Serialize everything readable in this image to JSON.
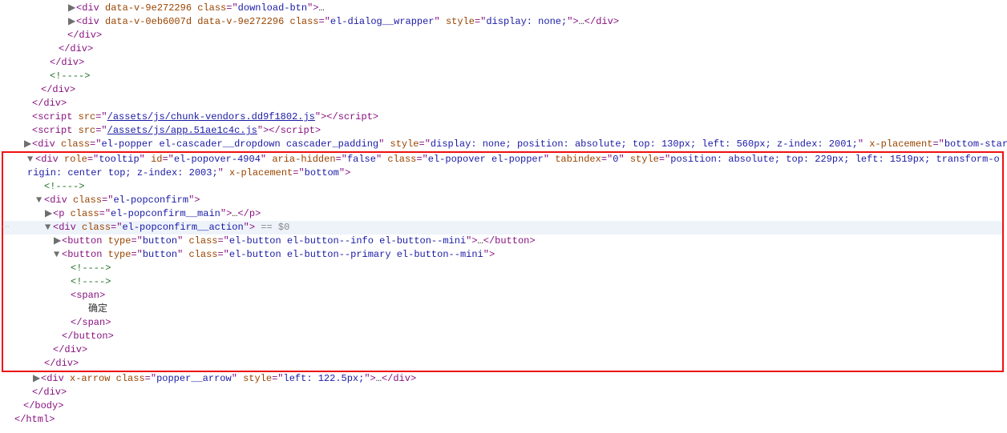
{
  "structure": {
    "nodes": [
      {
        "id": "n0",
        "indent": 7,
        "type": "open_ell",
        "caret": "right",
        "text": {
          "tag": "div",
          "attrs": [
            {
              "n": "data-v-9e272296",
              "v": ""
            },
            {
              "n": "class",
              "v": "download-btn"
            }
          ]
        }
      },
      {
        "id": "n1",
        "indent": 7,
        "type": "open_close_ell",
        "caret": "right",
        "text": {
          "tag": "div",
          "attrs": [
            {
              "n": "data-v-0eb6007d",
              "v": ""
            },
            {
              "n": "data-v-9e272296",
              "v": ""
            },
            {
              "n": "class",
              "v": "el-dialog__wrapper"
            },
            {
              "n": "style",
              "v": "display: none;"
            }
          ]
        }
      },
      {
        "id": "n2",
        "indent": 6,
        "type": "close",
        "text": {
          "tag": "div"
        }
      },
      {
        "id": "n3",
        "indent": 5,
        "type": "close",
        "text": {
          "tag": "div"
        }
      },
      {
        "id": "n4",
        "indent": 4,
        "type": "close",
        "text": {
          "tag": "div"
        }
      },
      {
        "id": "n5",
        "indent": 4,
        "type": "comment",
        "text": {
          "raw": "<!---->"
        }
      },
      {
        "id": "n6",
        "indent": 3,
        "type": "close",
        "text": {
          "tag": "div"
        }
      },
      {
        "id": "n7",
        "indent": 2,
        "type": "close",
        "text": {
          "tag": "div"
        }
      },
      {
        "id": "n8",
        "indent": 2,
        "type": "script",
        "text": {
          "src": "/assets/js/chunk-vendors.dd9f1802.js"
        }
      },
      {
        "id": "n9",
        "indent": 2,
        "type": "script",
        "text": {
          "src": "/assets/js/app.51ae1c4c.js"
        }
      },
      {
        "id": "n10",
        "indent": 2,
        "type": "open_close_ell",
        "caret": "right",
        "text": {
          "tag": "div",
          "attrs": [
            {
              "n": "class",
              "v": "el-popper el-cascader__dropdown cascader_padding"
            },
            {
              "n": "style",
              "v": "display: none; position: absolute; top: 130px; left: 560px; z-index: 2001;"
            },
            {
              "n": "x-placement",
              "v": "bottom-start"
            }
          ]
        }
      }
    ],
    "redbox_nodes": [
      {
        "id": "r0",
        "indent": 2,
        "type": "open",
        "caret": "down",
        "wrap": true,
        "text": {
          "tag": "div",
          "attrs": [
            {
              "n": "role",
              "v": "tooltip"
            },
            {
              "n": "id",
              "v": "el-popover-4904"
            },
            {
              "n": "aria-hidden",
              "v": "false"
            },
            {
              "n": "class",
              "v": "el-popover el-popper"
            },
            {
              "n": "tabindex",
              "v": "0"
            },
            {
              "n": "style",
              "v": "position: absolute; top: 229px; left: 1519px; transform-origin: center top; z-index: 2003;"
            },
            {
              "n": "x-placement",
              "v": "bottom"
            }
          ]
        }
      },
      {
        "id": "r1",
        "indent": 3,
        "type": "comment",
        "text": {
          "raw": "<!---->"
        }
      },
      {
        "id": "r2",
        "indent": 3,
        "type": "open",
        "caret": "down",
        "text": {
          "tag": "div",
          "attrs": [
            {
              "n": "class",
              "v": "el-popconfirm"
            }
          ]
        }
      },
      {
        "id": "r3",
        "indent": 4,
        "type": "open_close_ell",
        "caret": "right",
        "text": {
          "tag": "p",
          "attrs": [
            {
              "n": "class",
              "v": "el-popconfirm__main"
            }
          ]
        }
      },
      {
        "id": "r4",
        "indent": 4,
        "type": "open",
        "caret": "down",
        "hl": true,
        "eq0": true,
        "gutter": "⋯",
        "text": {
          "tag": "div",
          "attrs": [
            {
              "n": "class",
              "v": "el-popconfirm__action"
            }
          ]
        }
      },
      {
        "id": "r5",
        "indent": 5,
        "type": "open_close_ell",
        "caret": "right",
        "text": {
          "tag": "button",
          "attrs": [
            {
              "n": "type",
              "v": "button"
            },
            {
              "n": "class",
              "v": "el-button el-button--info el-button--mini"
            }
          ]
        }
      },
      {
        "id": "r6",
        "indent": 5,
        "type": "open",
        "caret": "down",
        "text": {
          "tag": "button",
          "attrs": [
            {
              "n": "type",
              "v": "button"
            },
            {
              "n": "class",
              "v": "el-button el-button--primary el-button--mini"
            }
          ]
        }
      },
      {
        "id": "r7",
        "indent": 6,
        "type": "comment",
        "text": {
          "raw": "<!---->"
        }
      },
      {
        "id": "r8",
        "indent": 6,
        "type": "comment",
        "text": {
          "raw": "<!---->"
        }
      },
      {
        "id": "r9",
        "indent": 6,
        "type": "open",
        "text": {
          "tag": "span"
        }
      },
      {
        "id": "r10",
        "indent": 8,
        "type": "textnode",
        "text": {
          "raw": "确定"
        }
      },
      {
        "id": "r11",
        "indent": 6,
        "type": "close",
        "text": {
          "tag": "span"
        }
      },
      {
        "id": "r12",
        "indent": 5,
        "type": "close",
        "text": {
          "tag": "button"
        }
      },
      {
        "id": "r13",
        "indent": 4,
        "type": "close",
        "text": {
          "tag": "div"
        }
      },
      {
        "id": "r14",
        "indent": 3,
        "type": "close",
        "text": {
          "tag": "div"
        }
      }
    ],
    "after_nodes": [
      {
        "id": "a0",
        "indent": 3,
        "type": "open_close_ell",
        "caret": "right",
        "text": {
          "tag": "div",
          "attrs": [
            {
              "n": "x-arrow",
              "v": ""
            },
            {
              "n": "class",
              "v": "popper__arrow"
            },
            {
              "n": "style",
              "v": "left: 122.5px;"
            }
          ]
        }
      },
      {
        "id": "a1",
        "indent": 2,
        "type": "close",
        "text": {
          "tag": "div"
        }
      },
      {
        "id": "a2",
        "indent": 1,
        "type": "close",
        "text": {
          "tag": "body"
        }
      },
      {
        "id": "a3",
        "indent": 0,
        "type": "close",
        "text": {
          "tag": "html"
        }
      }
    ]
  },
  "eq0_label": " == $0"
}
